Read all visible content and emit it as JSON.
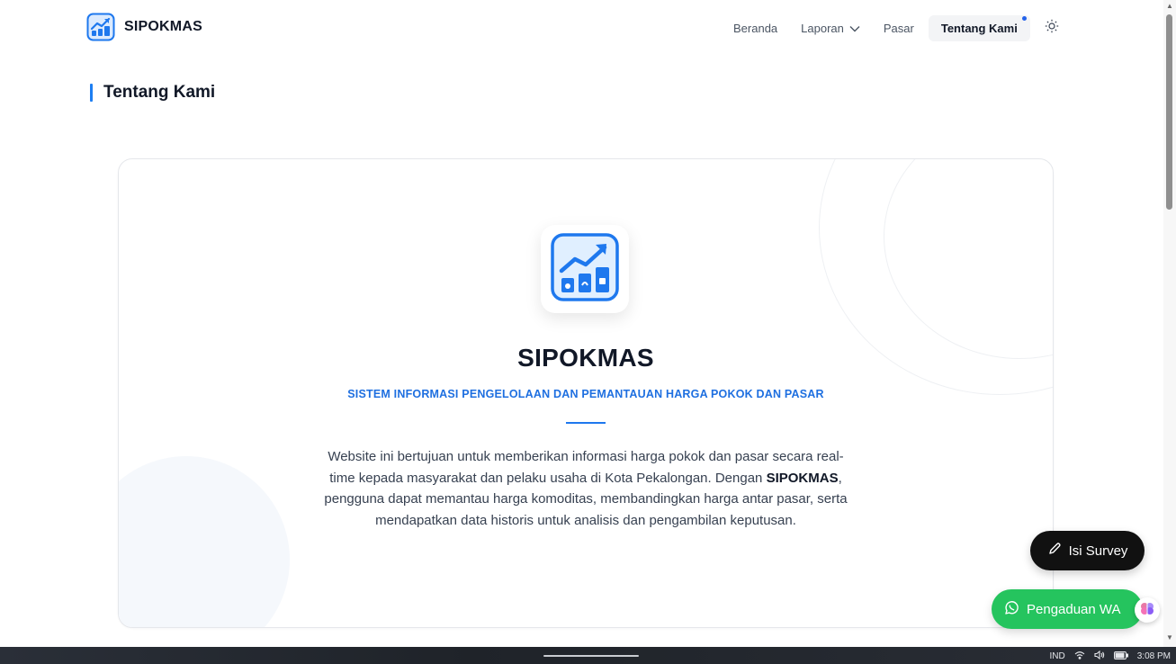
{
  "brand": {
    "name": "SIPOKMAS"
  },
  "nav": {
    "items": [
      {
        "label": "Beranda"
      },
      {
        "label": "Laporan"
      },
      {
        "label": "Pasar"
      },
      {
        "label": "Tentang Kami",
        "active": true
      }
    ]
  },
  "page": {
    "title": "Tentang Kami"
  },
  "card": {
    "title": "SIPOKMAS",
    "subtitle": "SISTEM INFORMASI PENGELOLAAN DAN PEMANTAUAN HARGA POKOK DAN PASAR",
    "desc_before": "Website ini bertujuan untuk memberikan informasi harga pokok dan pasar secara real-time kepada masyarakat dan pelaku usaha di Kota Pekalongan. Dengan ",
    "desc_bold": "SIPOKMAS",
    "desc_after": ", pengguna dapat memantau harga komoditas, membandingkan harga antar pasar, serta mendapatkan data historis untuk analisis dan pengambilan keputusan."
  },
  "floating": {
    "survey_label": "Isi Survey",
    "wa_label": "Pengaduan WA"
  },
  "taskbar": {
    "lang": "IND",
    "time": "3:08 PM"
  },
  "colors": {
    "accent": "#1e78ee",
    "whatsapp": "#25c45e",
    "survey": "#111111"
  },
  "icons": {
    "brand": "chart-growth-icon",
    "theme": "sun-icon",
    "survey": "pencil-icon",
    "wa": "whatsapp-icon",
    "ai": "brain-icon"
  }
}
